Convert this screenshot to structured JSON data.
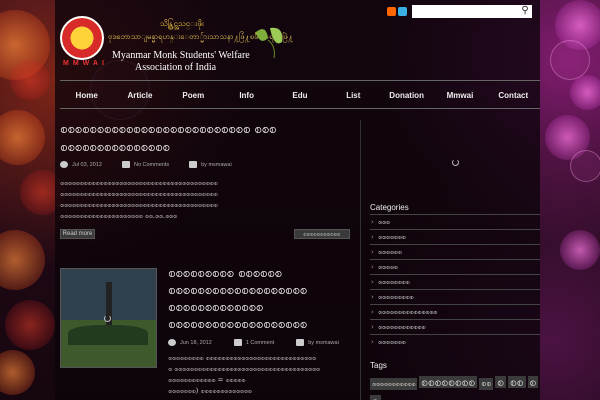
{
  "header": {
    "org_myanmar_line1": "သိန္တြင္အသင္းဖိုး",
    "org_myanmar_line2": "ဗုဒၶဘာသာျမန္မာရဟန္းေတာ္မ်ားသာသနာ႔ဖြံ႔ၿဖိဳးေရးအဖြဲ႔",
    "org_english_line1": "Myanmar Monk Students' Welfare",
    "org_english_line2": "Association of India",
    "logo_text": "MMWAI",
    "search_placeholder": ""
  },
  "nav": [
    "Home",
    "Article",
    "Poem",
    "Info",
    "Edu",
    "List",
    "Donation",
    "Mmwai",
    "Contact"
  ],
  "posts": [
    {
      "title_line1": "စစစစစစစစစစစစစစစစစစစစစစစစစစ စစစ",
      "title_line2": "စစစစစစစစစစစစစစစ",
      "date": "Jul 03, 2012",
      "comments": "No Comments",
      "author": "by msmawai",
      "excerpt": [
        "စစစစစစစစစစစစစစစစစစစစစစစစစစစစစစစစစစစစစစစစ",
        "စစစစစစစစစစစစစစစစစစစစစစစစစစစစစစစစစစစစစစစစ",
        "စစစစစစစစစစစစစစစစစစစစစစစစစစစစစစစစစစစစစစစစ",
        "စစစစစစစစစစစစစစစစစစစစစ စစ.စစ.စစစ"
      ],
      "read_more": "Read more",
      "secondary": "စစစစစစစစစစစ"
    },
    {
      "title_line1": "စစစစစစစစစ စစစစစစ",
      "title_line2": "စစစစစစစစစစစစစစစစစစစ",
      "title_line3": "စစစစစစစစစစစစစ",
      "title_line4": "စစစစစစစစစစစစစစစစစစစ",
      "date": "Jun 18, 2012",
      "comments": "1 Comment",
      "author": "by msmawai",
      "excerpt": [
        "စစစစစစစစစ စစစစစစစစစစစစစစစစစစစစစစစစစစစစ",
        "စ စစစစစစစစစစစစစစစစစစစစစစစစစစစစစစစစစစစစစ",
        "စစစစစစစစစစစစ   =   စစစစစ",
        "စစစစစစစ) စစစစစစစစစစစစစ"
      ]
    }
  ],
  "sidebar": {
    "categories_heading": "Categories",
    "categories": [
      "စစစ",
      "စစစစစစစ",
      "စစစစစစ",
      "စစစစစ",
      "စစစစစစစစ",
      "စစစစစစစစစ",
      "စစစစစစစစစစစစစစစ",
      "စစစစစစစစစစစစ",
      "စစစစစစစ"
    ],
    "tags_heading": "Tags",
    "tags": [
      "စစစစစစစစစစစ",
      "စစစစစစစစ",
      "စစ",
      "စ",
      "စစ",
      "စ",
      "စ"
    ]
  },
  "colors": {
    "accent": "#ffd64a",
    "bg": "#1a0a14"
  }
}
